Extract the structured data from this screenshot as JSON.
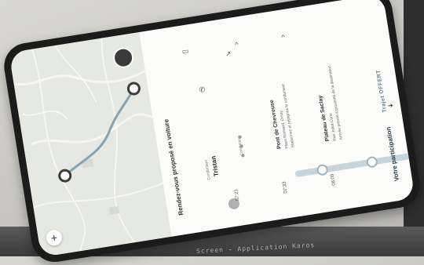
{
  "panel": {
    "title": "Rendez-vous proposé en voiture",
    "driver_label": "Conducteur",
    "driver_name": "Tristan",
    "step_time": "07:21",
    "seat_label": "Conducteur",
    "stops": [
      {
        "time": "07:33",
        "name": "Pont de Chevreuse",
        "line1": "Place Ronsard, Orsay",
        "line2": "Stationnez et rejoignez le conducteur"
      },
      {
        "time": "08:00",
        "name": "Plateau de Saclay",
        "line1": "Rue Joliot-Curie",
        "line2": "Arrivée prévue à proximité de la destination"
      }
    ],
    "participation_label": "Votre participation",
    "offer_label": "Trajet OFFERT"
  },
  "map": {
    "zoom_symbol": "+"
  },
  "footer": {
    "caption": "Screen - Application Karos"
  },
  "colors": {
    "accent": "#6b7f8f",
    "timeline": "#c7d4d9",
    "route": "#8aa2ad"
  },
  "icons": [
    "chat-icon",
    "phone-icon",
    "share-icon",
    "expand-icon",
    "arrow-right-icon",
    "plus-icon"
  ]
}
